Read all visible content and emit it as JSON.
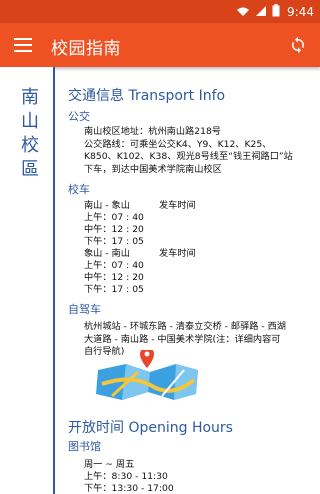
{
  "status_bar": {
    "time": "9:44"
  },
  "app_bar": {
    "title": "校园指南"
  },
  "side": {
    "chars": [
      "南",
      "山",
      "校",
      "區"
    ]
  },
  "transport": {
    "title": "交通信息 Transport Info",
    "bus": {
      "heading": "公交",
      "address": "南山校区地址：杭州南山路218号",
      "route_lines": [
        "公交路线：可乘坐公交K4、Y9、K12、K25、",
        "K850、K102、K38、观光8号线至“钱王祠路口”站",
        "下车，到达中国美术学院南山校区"
      ]
    },
    "shuttle": {
      "heading": "校车",
      "groups": [
        {
          "route": "南山 - 象山",
          "dep_label": "发车时间",
          "times": [
            "上午：07 : 40",
            "中午：12 : 20",
            "下午：17 : 05"
          ]
        },
        {
          "route": "象山 - 南山",
          "dep_label": "发车时间",
          "times": [
            "上午：07 : 40",
            "中午：12 : 20",
            "下午：17 : 05"
          ]
        }
      ]
    },
    "drive": {
      "heading": "自驾车",
      "lines": [
        "杭州城站 - 环城东路 - 清泰立交桥 - 邮驿路 - 西湖",
        "大道路 - 南山路 - 中国美术学院(注：详细内容可",
        "自行导航)"
      ]
    }
  },
  "hours": {
    "title": "开放时间 Opening Hours",
    "library": {
      "heading": "图书馆",
      "lines": [
        "周一 ~ 周五",
        "上午：8:30 - 11:30",
        "下午：13:30 - 17:00"
      ]
    }
  }
}
